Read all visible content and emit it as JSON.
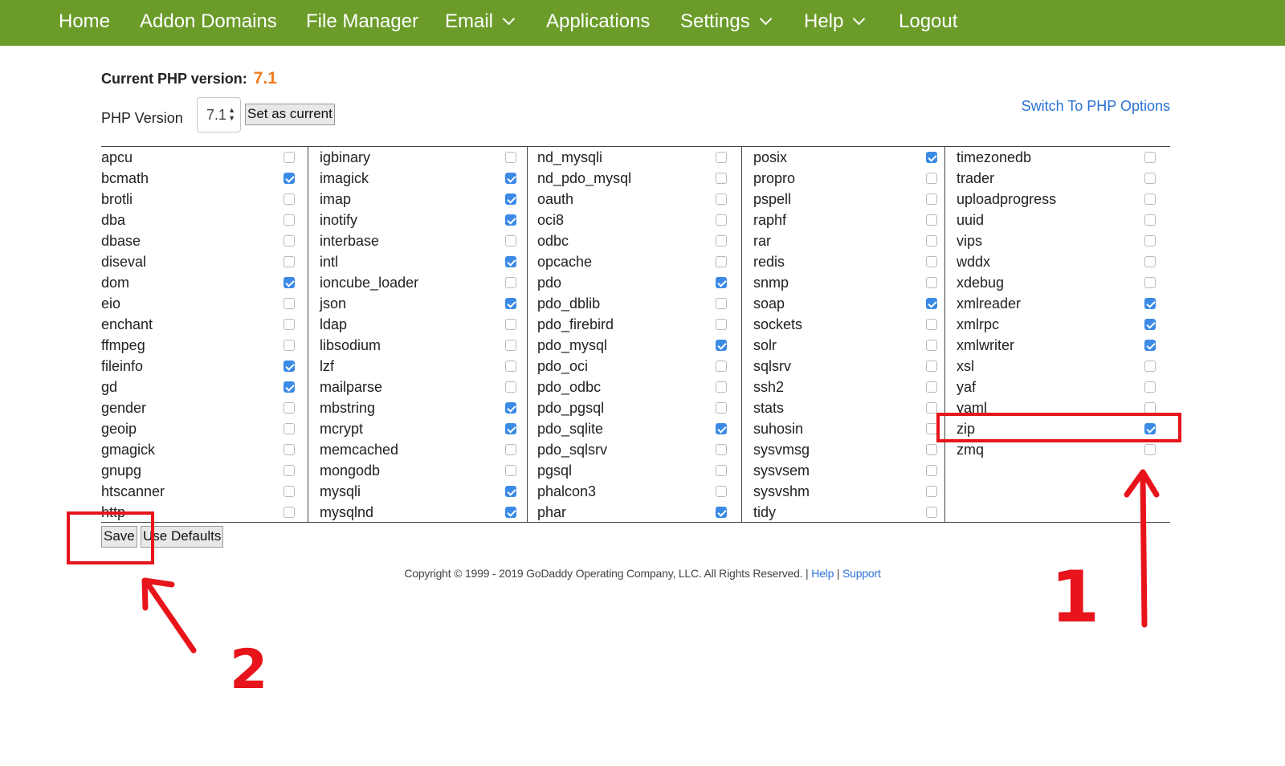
{
  "nav": {
    "items": [
      {
        "label": "Home",
        "dropdown": false
      },
      {
        "label": "Addon Domains",
        "dropdown": false
      },
      {
        "label": "File Manager",
        "dropdown": false
      },
      {
        "label": "Email",
        "dropdown": true
      },
      {
        "label": "Applications",
        "dropdown": false
      },
      {
        "label": "Settings",
        "dropdown": true
      },
      {
        "label": "Help",
        "dropdown": true
      },
      {
        "label": "Logout",
        "dropdown": false
      }
    ],
    "color": "#6b9c2a"
  },
  "php": {
    "current_label": "Current PHP version:",
    "current_value": "7.1",
    "version_label": "PHP Version",
    "selected_version": "7.1",
    "set_current_button": "Set as current",
    "switch_link": "Switch To PHP Options"
  },
  "extensions": {
    "columns": [
      [
        {
          "name": "apcu",
          "checked": false
        },
        {
          "name": "bcmath",
          "checked": true
        },
        {
          "name": "brotli",
          "checked": false
        },
        {
          "name": "dba",
          "checked": false
        },
        {
          "name": "dbase",
          "checked": false
        },
        {
          "name": "diseval",
          "checked": false
        },
        {
          "name": "dom",
          "checked": true
        },
        {
          "name": "eio",
          "checked": false
        },
        {
          "name": "enchant",
          "checked": false
        },
        {
          "name": "ffmpeg",
          "checked": false
        },
        {
          "name": "fileinfo",
          "checked": true
        },
        {
          "name": "gd",
          "checked": true
        },
        {
          "name": "gender",
          "checked": false
        },
        {
          "name": "geoip",
          "checked": false
        },
        {
          "name": "gmagick",
          "checked": false
        },
        {
          "name": "gnupg",
          "checked": false
        },
        {
          "name": "htscanner",
          "checked": false
        },
        {
          "name": "http",
          "checked": false
        }
      ],
      [
        {
          "name": "igbinary",
          "checked": false
        },
        {
          "name": "imagick",
          "checked": true
        },
        {
          "name": "imap",
          "checked": true
        },
        {
          "name": "inotify",
          "checked": true
        },
        {
          "name": "interbase",
          "checked": false
        },
        {
          "name": "intl",
          "checked": true
        },
        {
          "name": "ioncube_loader",
          "checked": false
        },
        {
          "name": "json",
          "checked": true
        },
        {
          "name": "ldap",
          "checked": false
        },
        {
          "name": "libsodium",
          "checked": false
        },
        {
          "name": "lzf",
          "checked": false
        },
        {
          "name": "mailparse",
          "checked": false
        },
        {
          "name": "mbstring",
          "checked": true
        },
        {
          "name": "mcrypt",
          "checked": true
        },
        {
          "name": "memcached",
          "checked": false
        },
        {
          "name": "mongodb",
          "checked": false
        },
        {
          "name": "mysqli",
          "checked": true
        },
        {
          "name": "mysqlnd",
          "checked": true
        }
      ],
      [
        {
          "name": "nd_mysqli",
          "checked": false
        },
        {
          "name": "nd_pdo_mysql",
          "checked": false
        },
        {
          "name": "oauth",
          "checked": false
        },
        {
          "name": "oci8",
          "checked": false
        },
        {
          "name": "odbc",
          "checked": false
        },
        {
          "name": "opcache",
          "checked": false
        },
        {
          "name": "pdo",
          "checked": true
        },
        {
          "name": "pdo_dblib",
          "checked": false
        },
        {
          "name": "pdo_firebird",
          "checked": false
        },
        {
          "name": "pdo_mysql",
          "checked": true
        },
        {
          "name": "pdo_oci",
          "checked": false
        },
        {
          "name": "pdo_odbc",
          "checked": false
        },
        {
          "name": "pdo_pgsql",
          "checked": false
        },
        {
          "name": "pdo_sqlite",
          "checked": true
        },
        {
          "name": "pdo_sqlsrv",
          "checked": false
        },
        {
          "name": "pgsql",
          "checked": false
        },
        {
          "name": "phalcon3",
          "checked": false
        },
        {
          "name": "phar",
          "checked": true
        }
      ],
      [
        {
          "name": "posix",
          "checked": true
        },
        {
          "name": "propro",
          "checked": false
        },
        {
          "name": "pspell",
          "checked": false
        },
        {
          "name": "raphf",
          "checked": false
        },
        {
          "name": "rar",
          "checked": false
        },
        {
          "name": "redis",
          "checked": false
        },
        {
          "name": "snmp",
          "checked": false
        },
        {
          "name": "soap",
          "checked": true
        },
        {
          "name": "sockets",
          "checked": false
        },
        {
          "name": "solr",
          "checked": false
        },
        {
          "name": "sqlsrv",
          "checked": false
        },
        {
          "name": "ssh2",
          "checked": false
        },
        {
          "name": "stats",
          "checked": false
        },
        {
          "name": "suhosin",
          "checked": false
        },
        {
          "name": "sysvmsg",
          "checked": false
        },
        {
          "name": "sysvsem",
          "checked": false
        },
        {
          "name": "sysvshm",
          "checked": false
        },
        {
          "name": "tidy",
          "checked": false
        }
      ],
      [
        {
          "name": "timezonedb",
          "checked": false
        },
        {
          "name": "trader",
          "checked": false
        },
        {
          "name": "uploadprogress",
          "checked": false
        },
        {
          "name": "uuid",
          "checked": false
        },
        {
          "name": "vips",
          "checked": false
        },
        {
          "name": "wddx",
          "checked": false
        },
        {
          "name": "xdebug",
          "checked": false
        },
        {
          "name": "xmlreader",
          "checked": true
        },
        {
          "name": "xmlrpc",
          "checked": true
        },
        {
          "name": "xmlwriter",
          "checked": true
        },
        {
          "name": "xsl",
          "checked": false
        },
        {
          "name": "yaf",
          "checked": false
        },
        {
          "name": "yaml",
          "checked": false
        },
        {
          "name": "zip",
          "checked": true
        },
        {
          "name": "zmq",
          "checked": false
        }
      ]
    ]
  },
  "actions": {
    "save": "Save",
    "defaults": "Use Defaults"
  },
  "footer": {
    "copyright": "Copyright © 1999 - 2019 GoDaddy Operating Company, LLC. All Rights Reserved.",
    "sep1": " | ",
    "help": "Help",
    "sep2": " | ",
    "support": "Support"
  },
  "annotations": {
    "marker_1": "1",
    "marker_2": "2",
    "color": "#e8141b"
  }
}
